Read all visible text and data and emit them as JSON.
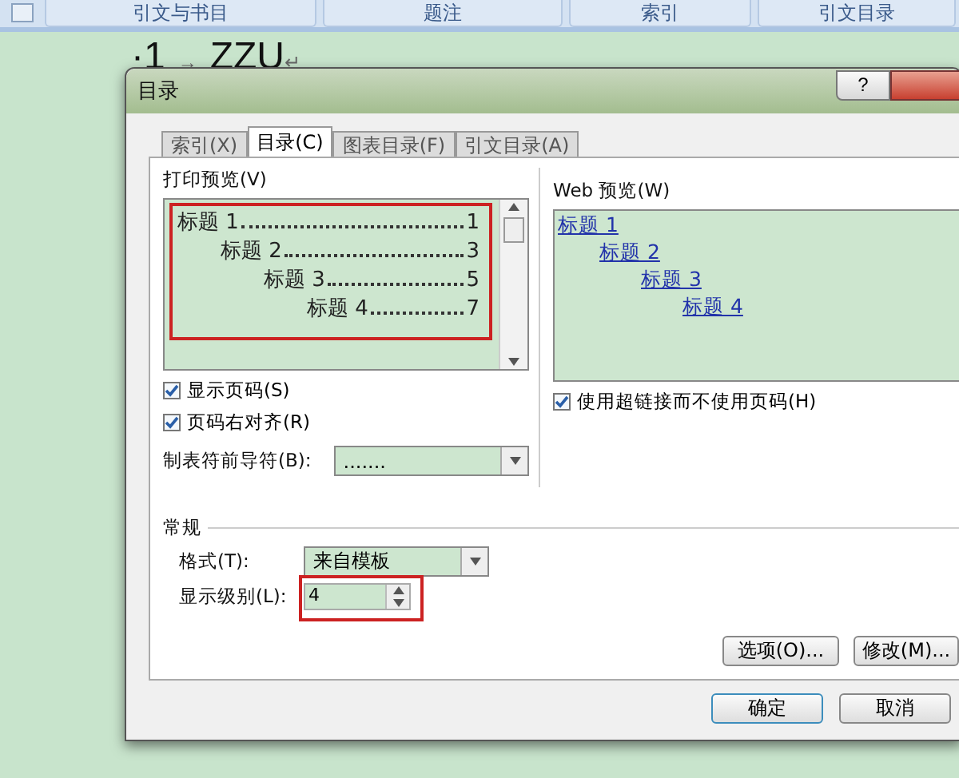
{
  "ribbon": {
    "buttons": [
      "引文与书目",
      "题注",
      "索引",
      "引文目录"
    ]
  },
  "document": {
    "heading_number": "·1",
    "tab_mark": "→",
    "heading_text": "ZZU",
    "paragraph_mark": "↵"
  },
  "dialog": {
    "title": "目录",
    "help_button": "?",
    "tabs": [
      {
        "label": "索引(X)",
        "selected": false
      },
      {
        "label": "目录(C)",
        "selected": true
      },
      {
        "label": "图表目录(F)",
        "selected": false
      },
      {
        "label": "引文目录(A)",
        "selected": false
      }
    ],
    "print_preview": {
      "label": "打印预览(V)",
      "annotated": true,
      "entries": [
        {
          "title": "标题 1",
          "page": "1",
          "children": [
            {
              "title": "标题 2",
              "page": "3",
              "children": [
                {
                  "title": "标题 3",
                  "page": "5",
                  "children": [
                    {
                      "title": "标题 4",
                      "page": "7"
                    }
                  ]
                }
              ]
            }
          ]
        }
      ]
    },
    "web_preview": {
      "label": "Web 预览(W)",
      "entries": [
        {
          "title": "标题 1",
          "children": [
            {
              "title": "标题 2",
              "children": [
                {
                  "title": "标题 3",
                  "children": [
                    {
                      "title": "标题 4"
                    }
                  ]
                }
              ]
            }
          ]
        }
      ]
    },
    "left_checkboxes": [
      {
        "label": "显示页码(S)",
        "checked": true
      },
      {
        "label": "页码右对齐(R)",
        "checked": true
      }
    ],
    "tab_leader": {
      "label": "制表符前导符(B):",
      "value": "......."
    },
    "right_checkbox": {
      "label": "使用超链接而不使用页码(H)",
      "checked": true
    },
    "general": {
      "label": "常规",
      "format": {
        "label": "格式(T):",
        "value": "来自模板"
      },
      "show_levels": {
        "label": "显示级别(L):",
        "value": "4",
        "annotated": true
      }
    },
    "buttons": {
      "options": "选项(O)...",
      "modify": "修改(M)...",
      "ok": "确定",
      "cancel": "取消"
    }
  }
}
